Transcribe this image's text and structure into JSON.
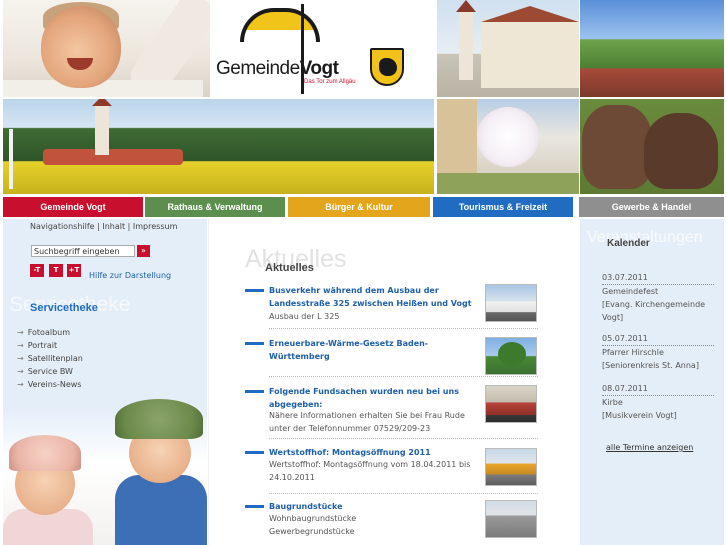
{
  "header": {
    "logo_word1": "Gemeinde",
    "logo_word2": "Vogt",
    "logo_tagline": "Das Tor zum Allgäu"
  },
  "nav": {
    "items": [
      {
        "label": "Gemeinde Vogt",
        "color": "#c8102e"
      },
      {
        "label": "Rathaus & Verwaltung",
        "color": "#5c8f4e"
      },
      {
        "label": "Bürger & Kultur",
        "color": "#e2a51c"
      },
      {
        "label": "Tourismus & Freizeit",
        "color": "#1f6cc0"
      },
      {
        "label": "Gewerbe & Handel",
        "color": "#8f8f8f"
      }
    ]
  },
  "meta_links": {
    "items": [
      "Navigationshilfe",
      "Inhalt",
      "Impressum"
    ],
    "separator": " | "
  },
  "search": {
    "placeholder": "Suchbegriff eingeben",
    "button_icon": "double-chevron-right-icon"
  },
  "font_size": {
    "small": "-T",
    "normal": "T",
    "large": "+T",
    "help_label": "Hilfe zur Darstellung"
  },
  "servicetheke": {
    "ghost": "Servicetheke",
    "title": "Servicetheke",
    "items": [
      "Fotoalbum",
      "Portrait",
      "Satellitenplan",
      "Service BW",
      "Vereins-News"
    ],
    "arrow": "→"
  },
  "aktuelles": {
    "ghost": "Aktuelles",
    "title": "Aktuelles",
    "items": [
      {
        "title_lines": [
          "Busverkehr während dem Ausbau der",
          "Landesstraße 325 zwischen Heißen und Vogt"
        ],
        "text_lines": [
          "Ausbau der L 325"
        ]
      },
      {
        "title_lines": [
          "Erneuerbare-Wärme-Gesetz Baden-Württemberg"
        ],
        "text_lines": []
      },
      {
        "title_lines": [
          "Folgende Fundsachen wurden neu bei uns",
          "abgegeben:"
        ],
        "text_lines": [
          "Nähere Informationen erhalten Sie bei Frau Rude",
          "unter der Telefonnummer 07529/209-23"
        ]
      },
      {
        "title_lines": [
          "Wertstoffhof: Montagsöffnung 2011"
        ],
        "text_lines": [
          "Wertstoffhof: Montagsöffnung vom 18.04.2011 bis",
          "24.10.2011"
        ]
      },
      {
        "title_lines": [
          "Baugrundstücke"
        ],
        "text_lines": [
          "Wohnbaugrundstücke",
          "Gewerbegrundstücke"
        ]
      }
    ]
  },
  "kalender": {
    "ghost": "Veranstaltungen",
    "title": "Kalender",
    "events": [
      {
        "date": "03.07.2011",
        "name": "Gemeindefest",
        "host_lines": [
          "[Evang. Kirchengemeinde",
          "Vogt]"
        ]
      },
      {
        "date": "05.07.2011",
        "name": "Pfarrer Hirschle",
        "host_lines": [
          "[Seniorenkreis St. Anna]"
        ]
      },
      {
        "date": "08.07.2011",
        "name": "Kirbe",
        "host_lines": [
          "[Musikverein Vogt]"
        ]
      }
    ],
    "all_link": "alle Termine anzeigen"
  }
}
